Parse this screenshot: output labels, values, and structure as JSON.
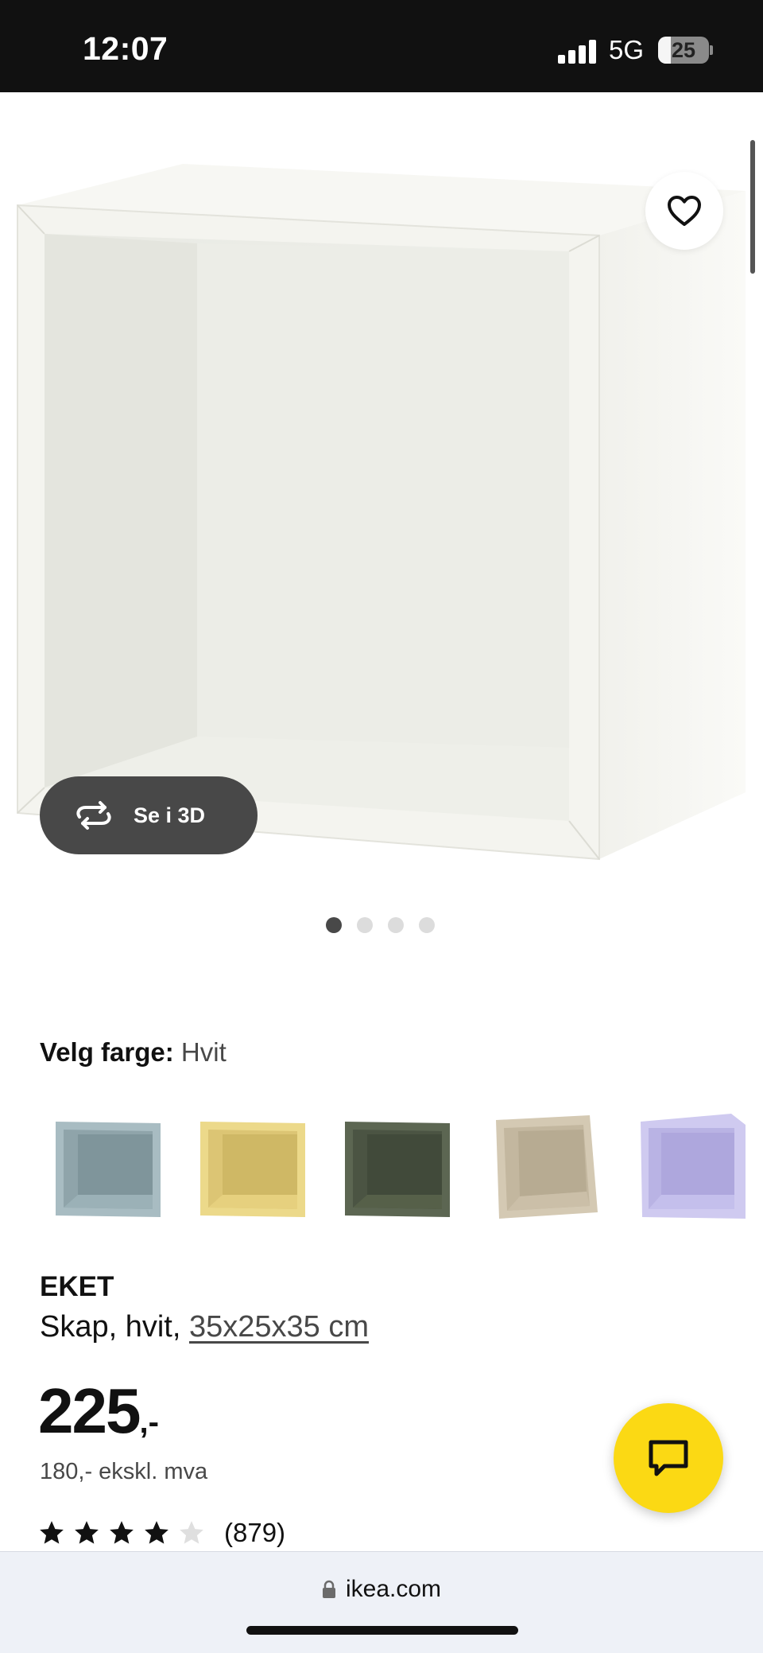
{
  "status_bar": {
    "time": "12:07",
    "network": "5G",
    "battery_percent": "25",
    "battery_level": 0.25
  },
  "product_image": {
    "see_3d_label": "Se i 3D",
    "carousel_dots": 4,
    "active_dot": 0
  },
  "color_selector": {
    "label": "Velg farge:",
    "selected": "Hvit",
    "swatches": [
      {
        "name": "swatch-blue-grey",
        "color": "#a8bcc2"
      },
      {
        "name": "swatch-yellow",
        "color": "#ecd98a"
      },
      {
        "name": "swatch-dark-green",
        "color": "#5c6652"
      },
      {
        "name": "swatch-beige",
        "color": "#d4c9b3"
      },
      {
        "name": "swatch-lilac",
        "color": "#c2bde8"
      }
    ]
  },
  "product": {
    "name": "EKET",
    "description_prefix": "Skap, hvit, ",
    "size_link": "35x25x35 cm",
    "price_main": "225",
    "price_suffix": ",-",
    "price_ex_vat": "180,- ekskl. mva",
    "rating_value": 4,
    "rating_max": 5,
    "review_count": "(879)"
  },
  "browser": {
    "url": "ikea.com"
  },
  "colors": {
    "accent_yellow": "#fbd914",
    "dark_pill": "#484848",
    "text": "#111111"
  }
}
